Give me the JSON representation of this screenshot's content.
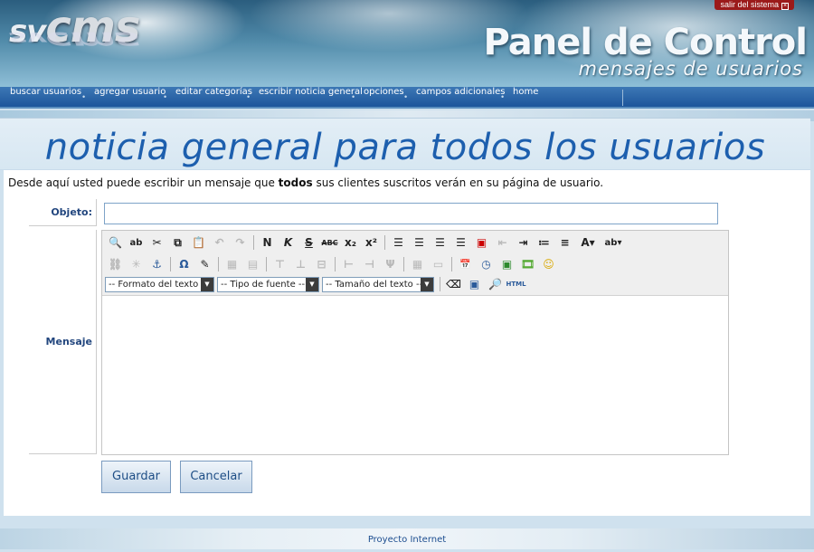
{
  "header": {
    "logo_prefix": "sv",
    "logo_main": "cms",
    "title": "Panel de Control",
    "subtitle": "mensajes de  usuarios",
    "logout_label": "salir del sistema",
    "logout_icon": "close-box-icon"
  },
  "nav": {
    "items": [
      "buscar usuarios",
      "agregar usuario",
      "editar categorías",
      "escribir noticia general",
      "opciones",
      "campos adicionales",
      "home"
    ]
  },
  "page": {
    "heading": "noticia general para todos los usuarios",
    "intro_before": "Desde aquí usted puede escribir un mensaje que ",
    "intro_bold": "todos",
    "intro_after": " sus clientes suscritos verán en  su página de usuario."
  },
  "form": {
    "subject_label": "Objeto:",
    "subject_value": "",
    "message_label": "Mensaje",
    "message_value": "",
    "save_label": "Guardar",
    "cancel_label": "Cancelar"
  },
  "editor": {
    "format_select": "-- Formato del texto --",
    "font_select": "-- Tipo de fuente --",
    "size_select": "-- Tamaño del texto --",
    "html_label": "HTML",
    "row1": [
      "find-icon",
      "replace-icon",
      "cut-icon",
      "copy-icon",
      "paste-icon",
      "undo-icon",
      "redo-icon",
      "bold-icon",
      "italic-icon",
      "strikethrough-icon",
      "abc-strike-icon",
      "subscript-icon",
      "superscript-icon",
      "align-left-icon",
      "align-center-icon",
      "align-right-icon",
      "justify-icon",
      "clean-icon",
      "outdent-icon",
      "indent-icon",
      "bullet-list-icon",
      "numbered-list-icon",
      "font-color-icon",
      "highlight-color-icon"
    ],
    "row2": [
      "link-icon",
      "unlink-icon",
      "anchor-icon",
      "special-char-icon",
      "edit-icon",
      "table-icon",
      "table-props-icon",
      "row-before-icon",
      "row-after-icon",
      "delete-row-icon",
      "col-before-icon",
      "col-after-icon",
      "delete-col-icon",
      "split-cells-icon",
      "merge-cells-icon",
      "insert-date-icon",
      "insert-time-icon",
      "image-icon",
      "media-icon",
      "emoticon-icon"
    ],
    "row3": [
      "eraser-icon",
      "fullscreen-icon",
      "preview-icon",
      "html-source-icon"
    ]
  },
  "footer": {
    "text": "Proyecto Internet"
  }
}
